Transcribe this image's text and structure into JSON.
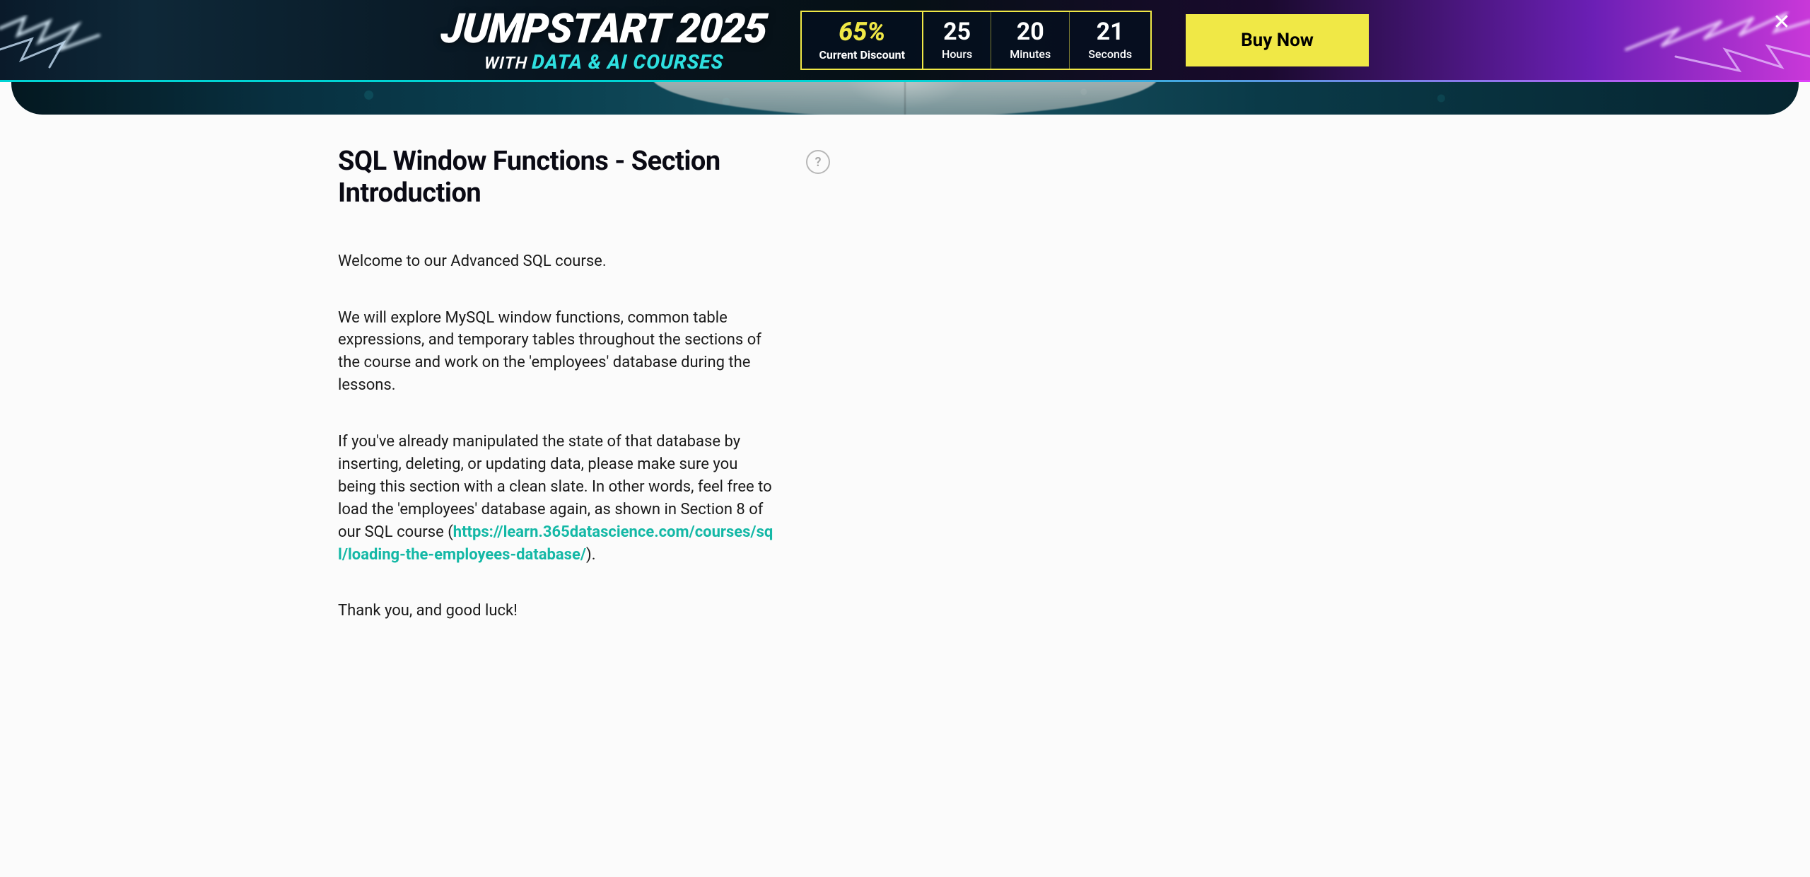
{
  "promo": {
    "title_main": "JUMPSTART 2025",
    "title_with": "WITH",
    "title_colored": "DATA & AI COURSES",
    "discount_value": "65%",
    "discount_label": "Current Discount",
    "hours_value": "25",
    "hours_label": "Hours",
    "minutes_value": "20",
    "minutes_label": "Minutes",
    "seconds_value": "21",
    "seconds_label": "Seconds",
    "buy_label": "Buy Now",
    "close_label": "✕"
  },
  "page": {
    "title": "SQL Window Functions - Section Introduction",
    "help_symbol": "?",
    "p1": "Welcome to our Advanced SQL course.",
    "p2": "We will explore MySQL window functions, common table expressions, and temporary tables throughout the sections of the course and work on the 'employees' database during the lessons.",
    "p3_before": "If you've already manipulated the state of that database by inserting, deleting, or updating data, please make sure you being this section with a clean slate. In other words, feel free to load the 'employees' database again, as shown in Section 8 of our SQL course (",
    "p3_link": "https://learn.365datascience.com/courses/sql/loading-the-employees-database/",
    "p3_after": ").",
    "p4": "Thank you, and good luck!"
  }
}
